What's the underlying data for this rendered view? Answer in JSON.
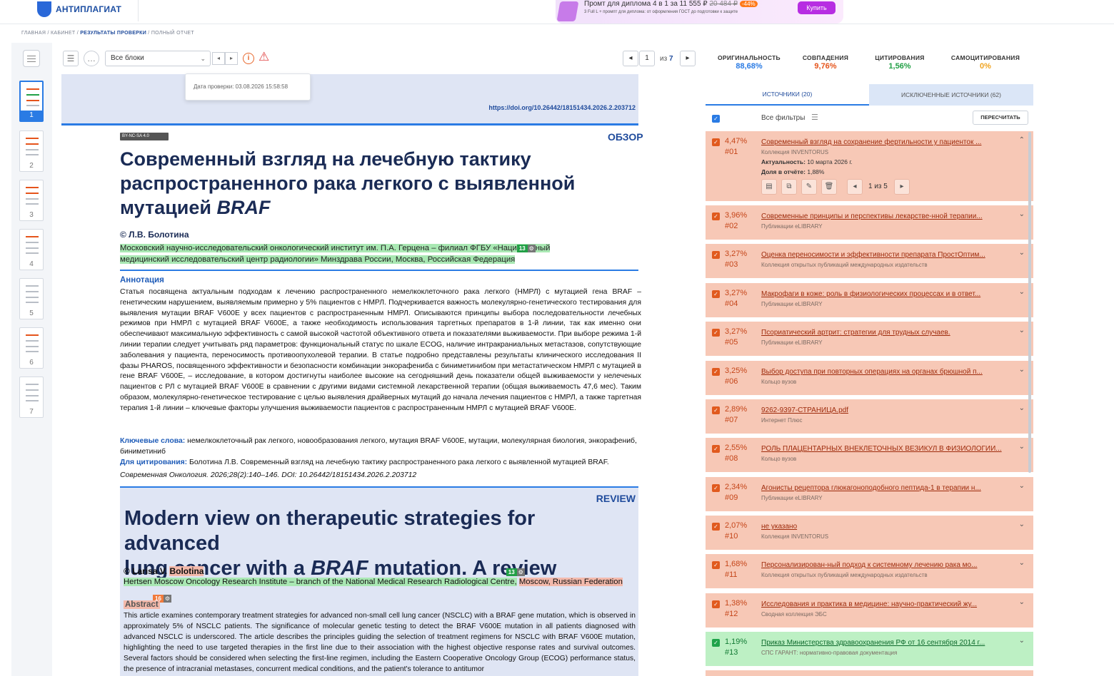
{
  "header": {
    "logo_text": "АНТИПЛАГИАТ",
    "promo_title": "Промт для диплома 4 в 1 за 11 555 ₽",
    "promo_old_price": "20 484 ₽",
    "promo_badge": "-44%",
    "promo_sub": "3 Full L + промпт для диплома: от оформления ГОСТ до подготовки к защите",
    "promo_button": "Купить"
  },
  "breadcrumbs": {
    "home": "ГЛАВНАЯ",
    "cabinet": "КАБИНЕТ",
    "results": "РЕЗУЛЬТАТЫ ПРОВЕРКИ",
    "current": "ПОЛНЫЙ ОТЧЕТ",
    "sep": " / "
  },
  "toolbar": {
    "blocks_select": "Все блоки",
    "page_current": "1",
    "page_of": "из",
    "page_total": "7"
  },
  "tooltip": {
    "text": "Дата проверки: 03.08.2026 15:58:58"
  },
  "thumbnails": [
    "1",
    "2",
    "3",
    "4",
    "5",
    "6",
    "7"
  ],
  "document": {
    "doi": "https://doi.org/10.26442/18151434.2026.2.203712",
    "license": "BY-NC-SA 4.0",
    "type_ru": "ОБЗОР",
    "title_ru_1": "Современный взгляд на лечебную тактику",
    "title_ru_2": "распространенного рака легкого с выявленной",
    "title_ru_3": "мутацией",
    "title_ru_gene": "BRAF",
    "author_ru": "© Л.В. Болотина",
    "affil_ru_1": "Московский научно-исследовательский онкологический институт им. П.А. Герцена – филиал ФГБУ «Наци",
    "affil_ru_tag": "13",
    "affil_ru_1b": "ный",
    "affil_ru_2": "медицинский исследовательский центр радиологии» Минздрава России, Москва, Российская Федерация",
    "annotation_heading": "Аннотация",
    "annotation": "Статья посвящена актуальным подходам к лечению распространенного немелкоклеточного рака легкого (НМРЛ) с мутацией гена BRAF – генетическим нарушением, выявляемым примерно у 5% пациентов с НМРЛ. Подчеркивается важность молекулярно-генетического тестирования для выявления мутации BRAF V600E у всех пациентов с распространенным НМРЛ. Описываются принципы выбора последовательности лечебных режимов при НМРЛ с мутацией BRAF V600E, а также необходимость использования таргетных препаратов в 1-й линии, так как именно они обеспечивают максимальную эффективность с самой высокой частотой объективного ответа и показателями выживаемости. При выборе режима 1-й линии терапии следует учитывать ряд параметров: функциональный статус по шкале ECOG, наличие интракраниальных метастазов, сопутствующие заболевания у пациента, переносимость противоопухолевой терапии. В статье подробно представлены результаты клинического исследования II фазы PHAROS, посвященного эффективности и безопасности комбинации энкорафениба с биниметинибом при метастатическом НМРЛ с мутацией в гене BRAF V600E, – исследование, в котором достигнуты наиболее высокие на сегодняшний день показатели общей выживаемости у нелеченых пациентов с РЛ с мутацией BRAF V600E в сравнении с другими видами системной лекарственной терапии (общая выживаемость 47,6 мес). Таким образом, молекулярно-генетическое тестирование с целью выявления драйверных мутаций до начала лечения пациентов с НМРЛ, а также таргетная терапия 1-й линии – ключевые факторы улучшения выживаемости пациентов с распространенным НМРЛ с мутацией BRAF V600E.",
    "keywords_label": "Ключевые слова:",
    "keywords": "немелкоклеточный рак легкого, новообразования легкого, мутация BRAF V600E, мутации, молекулярная биология, энкорафениб, биниметиниб",
    "cite_label": "Для цитирования:",
    "cite": "Болотина Л.В. Современный взгляд на лечебную тактику распространенного рака легкого с выявленной мутацией BRAF.",
    "cite_2": "Современная Онкология. 2026;28(2):140–146. DOI: 10.26442/18151434.2026.2.203712",
    "type_en": "REVIEW",
    "title_en_1": "Modern view on therapeutic strategies for advanced",
    "title_en_2a": "lung cancer with a",
    "title_en_gene": "BRAF",
    "title_en_2b": "mutation. A review",
    "author_en_a": "© Larisa V.",
    "author_en_b": "Bolotina",
    "author_tag": "13",
    "affil_en_a": "Hertsen Moscow Oncology Research Institute – branch of the National Medical Research Radiological Centre,",
    "affil_en_b": "Moscow, Russian Federation",
    "abstract_tag": "16",
    "abstract_heading": "Abstract",
    "abstract": "This article examines contemporary treatment strategies for advanced non-small cell lung cancer (NSCLC) with a BRAF gene mutation, which is observed in approximately 5% of NSCLC patients. The significance of molecular genetic testing to detect the BRAF V600E mutation in all patients diagnosed with advanced NSCLC is underscored. The article describes the principles guiding the selection of treatment regimens for NSCLC with BRAF V600E mutation, highlighting the need to use targeted therapies in the first line due to their association with the highest objective response rates and survival outcomes. Several factors should be considered when selecting the first-line regimen, including the Eastern Cooperative Oncology Group (ECOG) performance status, the presence of intracranial metastases, concurrent medical conditions, and the patient's tolerance to antitumor"
  },
  "stats": [
    {
      "label": "ОРИГИНАЛЬНОСТЬ",
      "value": "88,68%",
      "color": "#2a7be4"
    },
    {
      "label": "СОВПАДЕНИЯ",
      "value": "9,76%",
      "color": "#e5541b"
    },
    {
      "label": "ЦИТИРОВАНИЯ",
      "value": "1,56%",
      "color": "#22a046"
    },
    {
      "label": "САМОЦИТИРОВАНИЯ",
      "value": "0%",
      "color": "#f0a420"
    }
  ],
  "tabs": {
    "sources": "ИСТОЧНИКИ (20)",
    "excluded": "ИСКЛЮЧЕННЫЕ ИСТОЧНИКИ (62)"
  },
  "filters": {
    "label": "Все фильтры",
    "recalc": "ПЕРЕСЧИТАТЬ"
  },
  "sources": [
    {
      "pct": "4,47%",
      "idx": "#01",
      "title": "Современный взгляд на сохранение фертильности у пациенток ...",
      "coll": "Коллекция INVENTORUS",
      "actual_label": "Актуальность:",
      "actual": "10 марта 2026 г.",
      "share_label": "Доля в отчёте:",
      "share": "1,88%",
      "pager": "1 из 5"
    },
    {
      "pct": "3,96%",
      "idx": "#02",
      "title": "Современные принципы и перспективы лекарстве-нной терапии...",
      "coll": "Публикации eLIBRARY"
    },
    {
      "pct": "3,27%",
      "idx": "#03",
      "title": "Оценка переносимости и эффективности препарата ПростОптим...",
      "coll": "Коллекция открытых публикаций международных издательств"
    },
    {
      "pct": "3,27%",
      "idx": "#04",
      "title": "Макрофаги в коже: роль в физиологических процессах и в ответ...",
      "coll": "Публикации eLIBRARY"
    },
    {
      "pct": "3,27%",
      "idx": "#05",
      "title": "Псориатический артрит: стратегии для трудных случаев.",
      "coll": "Публикации eLIBRARY"
    },
    {
      "pct": "3,25%",
      "idx": "#06",
      "title": "Выбор доступа при повторных операциях на органах брюшной п...",
      "coll": "Кольцо вузов"
    },
    {
      "pct": "2,89%",
      "idx": "#07",
      "title": "9262-9397-СТРАНИЦА.pdf",
      "coll": "Интернет Плюс"
    },
    {
      "pct": "2,55%",
      "idx": "#08",
      "title": "РОЛЬ ПЛАЦЕНТАРНЫХ ВНЕКЛЕТОЧНЫХ ВЕЗИКУЛ В ФИЗИОЛОГИИ...",
      "coll": "Кольцо вузов"
    },
    {
      "pct": "2,34%",
      "idx": "#09",
      "title": "Агонисты рецептора глюкагоноподобного пептида-1 в терапии н...",
      "coll": "Публикации eLIBRARY"
    },
    {
      "pct": "2,07%",
      "idx": "#10",
      "title": "не указано",
      "coll": "Коллекция INVENTORUS"
    },
    {
      "pct": "1,68%",
      "idx": "#11",
      "title": "Персонализирован-ный подход к системному лечению рака мо...",
      "coll": "Коллекция открытых публикаций международных издательств"
    },
    {
      "pct": "1,38%",
      "idx": "#12",
      "title": "Исследования и практика в медицине: научно-практический жу...",
      "coll": "Сводная коллекция ЭБС"
    },
    {
      "pct": "1,19%",
      "idx": "#13",
      "title": "Приказ Министерства здравоохранения РФ от 16 сентября 2014 г...",
      "coll": "СПС ГАРАНТ: нормативно-правовая документация"
    }
  ]
}
